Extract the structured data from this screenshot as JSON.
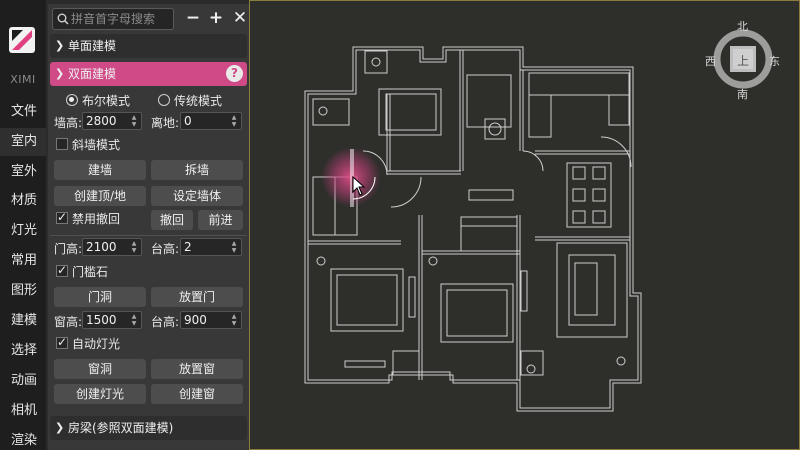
{
  "toolbar": {
    "brand": "XIMI",
    "items": [
      "文件",
      "室内",
      "室外",
      "材质",
      "灯光",
      "常用",
      "图形",
      "建模",
      "选择",
      "动画",
      "相机",
      "渲染"
    ],
    "active_index": 1
  },
  "panel": {
    "search_placeholder": "拼音首字母搜索",
    "section_single": "单面建模",
    "section_double": "双面建模",
    "help_label": "?",
    "mode_bool": "布尔模式",
    "mode_traditional": "传统模式",
    "wall_height_label": "墙高:",
    "wall_height_value": "2800",
    "floor_offset_label": "离地:",
    "floor_offset_value": "0",
    "slant_wall_label": "斜墙模式",
    "btn_build_wall": "建墙",
    "btn_remove_wall": "拆墙",
    "btn_create_ceiling_floor": "创建顶/地",
    "btn_set_wall": "设定墙体",
    "disable_undo_label": "禁用撤回",
    "btn_undo": "撤回",
    "btn_redo": "前进",
    "door_height_label": "门高:",
    "door_height_value": "2100",
    "sill_height_label_1": "台高:",
    "sill_height_value_1": "2",
    "threshold_label": "门槛石",
    "btn_door_hole": "门洞",
    "btn_place_door": "放置门",
    "window_height_label": "窗高:",
    "window_height_value": "1500",
    "sill_height_label_2": "台高:",
    "sill_height_value_2": "900",
    "auto_light_label": "自动灯光",
    "btn_window_hole": "窗洞",
    "btn_place_window": "放置窗",
    "btn_create_light": "创建灯光",
    "btn_create_window": "创建窗",
    "section_beam": "房梁(参照双面建模)"
  },
  "viewcube": {
    "north": "北",
    "south": "南",
    "east": "东",
    "west": "西",
    "face": "上"
  },
  "colors": {
    "accent": "#cf4a86",
    "panel_bg": "#383838",
    "viewport_bg": "#2e2e2b",
    "plan_lines": "#cfcfcf"
  }
}
